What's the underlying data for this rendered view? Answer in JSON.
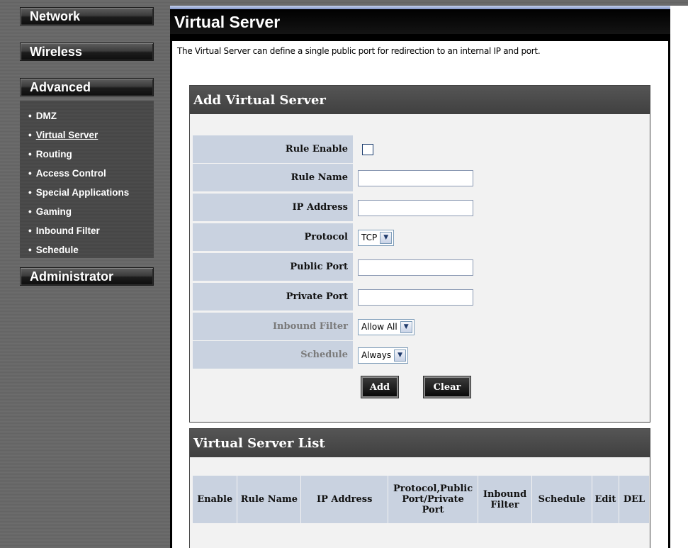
{
  "sidebar": {
    "network": "Network",
    "wireless": "Wireless",
    "advanced": "Advanced",
    "advanced_items": [
      {
        "label": "DMZ"
      },
      {
        "label": "Virtual Server"
      },
      {
        "label": "Routing"
      },
      {
        "label": "Access Control"
      },
      {
        "label": "Special Applications"
      },
      {
        "label": "Gaming"
      },
      {
        "label": "Inbound Filter"
      },
      {
        "label": "Schedule"
      }
    ],
    "administrator": "Administrator",
    "bullet": "•"
  },
  "page": {
    "title": "Virtual Server",
    "description": "The Virtual Server can define a single public port for redirection to an internal IP and port."
  },
  "add_panel": {
    "title": "Add Virtual Server",
    "rule_enable": "Rule Enable",
    "rule_name": "Rule Name",
    "rule_name_value": "",
    "ip_address": "IP Address",
    "ip_address_value": "",
    "protocol": "Protocol",
    "protocol_value": "TCP",
    "public_port": "Public Port",
    "public_port_value": "",
    "private_port": "Private Port",
    "private_port_value": "",
    "inbound_filter": "Inbound Filter",
    "inbound_filter_value": "Allow All",
    "schedule": "Schedule",
    "schedule_value": "Always",
    "add_button": "Add",
    "clear_button": "Clear"
  },
  "list_panel": {
    "title": "Virtual Server List",
    "columns": [
      "Enable",
      "Rule Name",
      "IP Address",
      "Protocol,Public Port/Private Port",
      "Inbound Filter",
      "Schedule",
      "Edit",
      "DEL"
    ]
  },
  "colors": {
    "label_bg": "#c9d2e0",
    "panel_header": "#404040"
  }
}
